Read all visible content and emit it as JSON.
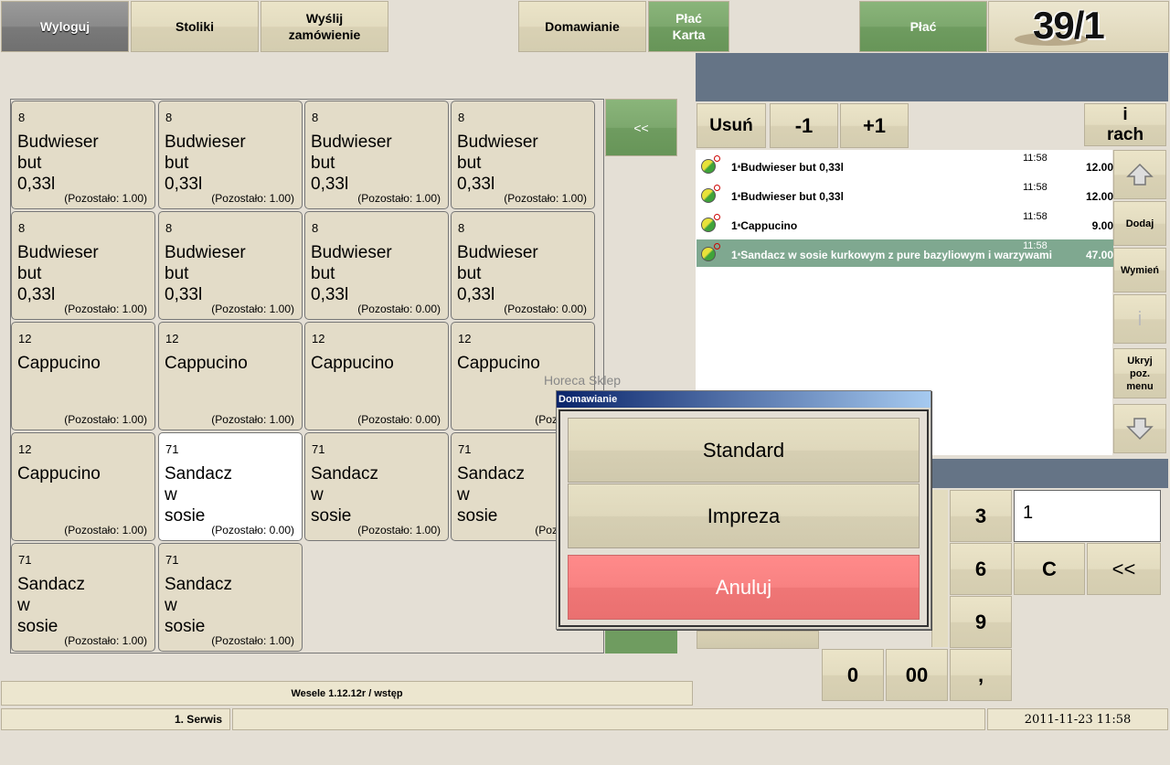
{
  "toolbar": {
    "logout": "Wyloguj",
    "tables": "Stoliki",
    "send_order": "Wyślij zamówienie",
    "add_on": "Domawianie",
    "pay_card": "Płać Karta",
    "pay": "Płać",
    "table_number": "39/1"
  },
  "tiles": [
    {
      "code": "8",
      "name": "Budwieser\nbut\n0,33l",
      "rest": "(Pozostało: 1.00)"
    },
    {
      "code": "8",
      "name": "Budwieser\nbut\n0,33l",
      "rest": "(Pozostało: 1.00)"
    },
    {
      "code": "8",
      "name": "Budwieser\nbut\n0,33l",
      "rest": "(Pozostało: 1.00)"
    },
    {
      "code": "8",
      "name": "Budwieser\nbut\n0,33l",
      "rest": "(Pozostało: 1.00)"
    },
    {
      "code": "8",
      "name": "Budwieser\nbut\n0,33l",
      "rest": "(Pozostało: 1.00)"
    },
    {
      "code": "8",
      "name": "Budwieser\nbut\n0,33l",
      "rest": "(Pozostało: 1.00)"
    },
    {
      "code": "8",
      "name": "Budwieser\nbut\n0,33l",
      "rest": "(Pozostało: 0.00)"
    },
    {
      "code": "8",
      "name": "Budwieser\nbut\n0,33l",
      "rest": "(Pozostało: 0.00)"
    },
    {
      "code": "12",
      "name": "Cappucino",
      "rest": "(Pozostało: 1.00)"
    },
    {
      "code": "12",
      "name": "Cappucino",
      "rest": "(Pozostało: 1.00)"
    },
    {
      "code": "12",
      "name": "Cappucino",
      "rest": "(Pozostało: 0.00)"
    },
    {
      "code": "12",
      "name": "Cappucino",
      "rest": "(Pozostało"
    },
    {
      "code": "12",
      "name": "Cappucino",
      "rest": "(Pozostało: 1.00)"
    },
    {
      "code": "71",
      "name": "Sandacz\nw\nsosie",
      "rest": "(Pozostało: 0.00)"
    },
    {
      "code": "71",
      "name": "Sandacz\nw\nsosie",
      "rest": "(Pozostało: 1.00)"
    },
    {
      "code": "71",
      "name": "Sandacz\nw\nsosie",
      "rest": "(Pozostało"
    },
    {
      "code": "71",
      "name": "Sandacz\nw\nsosie",
      "rest": "(Pozostało: 1.00)"
    },
    {
      "code": "71",
      "name": "Sandacz\nw\nsosie",
      "rest": "(Pozostało: 1.00)"
    }
  ],
  "nav": {
    "back": "<<"
  },
  "order": {
    "remove": "Usuń",
    "minus": "-1",
    "plus": "+1",
    "bill": "i rach",
    "items": [
      {
        "qty": "1",
        "name": "Budwieser but 0,33l",
        "time": "11:58",
        "price": "12.00"
      },
      {
        "qty": "1",
        "name": "Budwieser but 0,33l",
        "time": "11:58",
        "price": "12.00"
      },
      {
        "qty": "1",
        "name": "Cappucino",
        "time": "11:58",
        "price": "9.00"
      },
      {
        "qty": "1",
        "name": "Sandacz w sosie kurkowym z  pure bazyliowym i warzywami",
        "time": "11:58",
        "price": "47.00"
      }
    ]
  },
  "side": {
    "add": "Dodaj",
    "replace": "Wymień",
    "info": "i",
    "hide": "Ukryj poz. menu"
  },
  "keypad": {
    "k3": "3",
    "k6": "6",
    "k9": "9",
    "k0": "0",
    "k00": "00",
    "comma": ",",
    "clear": "C",
    "backspace": "<<",
    "display": "1"
  },
  "dialog": {
    "ghost_title": "Horeca Sklep",
    "title": "Domawianie",
    "standard": "Standard",
    "party": "Impreza",
    "cancel": "Anuluj"
  },
  "status": {
    "menu_path": "Wesele 1.12.12r / wstęp",
    "service": "1. Serwis",
    "datetime": "2011-11-23  11:58"
  }
}
